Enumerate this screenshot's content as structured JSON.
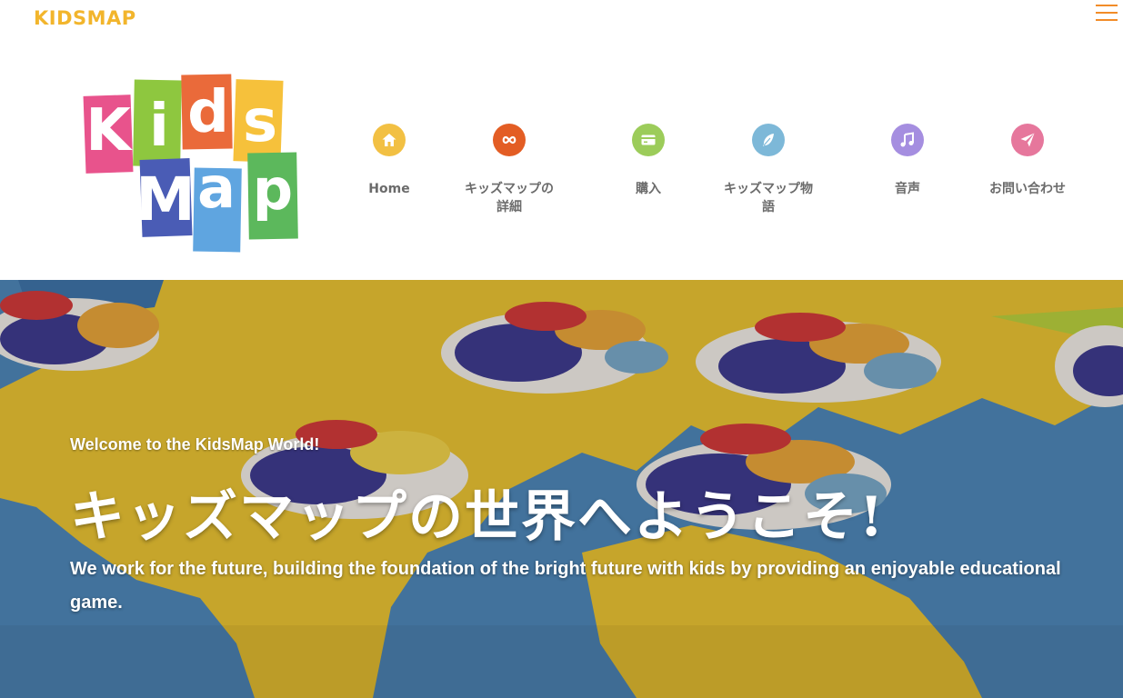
{
  "header": {
    "brand": "KIDSMAP",
    "menu_icon": "hamburger-menu-icon"
  },
  "logo": {
    "letters_top": [
      "K",
      "i",
      "d",
      "s"
    ],
    "letters_bottom": [
      "M",
      "a",
      "p"
    ],
    "colors": [
      "#e8538c",
      "#8ec73f",
      "#ea6a3a",
      "#f6c13b",
      "#4a5cb5",
      "#5fa5e0",
      "#5cb85c"
    ]
  },
  "nav": {
    "items": [
      {
        "label": "Home",
        "icon": "home-icon",
        "color": "#f2c043"
      },
      {
        "label": "キッズマップの詳細",
        "icon": "infinity-icon",
        "color": "#e35d24"
      },
      {
        "label": "購入",
        "icon": "credit-card-icon",
        "color": "#9ccc5a"
      },
      {
        "label": "キッズマップ物語",
        "icon": "feather-icon",
        "color": "#7db8d8"
      },
      {
        "label": "音声",
        "icon": "music-note-icon",
        "color": "#a58ee0"
      },
      {
        "label": "お問い合わせ",
        "icon": "paper-plane-icon",
        "color": "#e6779c"
      }
    ]
  },
  "hero": {
    "subtitle": "Welcome to the KidsMap World!",
    "title": "キッズマップの世界へようこそ!",
    "description": "We work for the future, building the foundation of the bright future with kids by providing an enjoyable educational game."
  }
}
